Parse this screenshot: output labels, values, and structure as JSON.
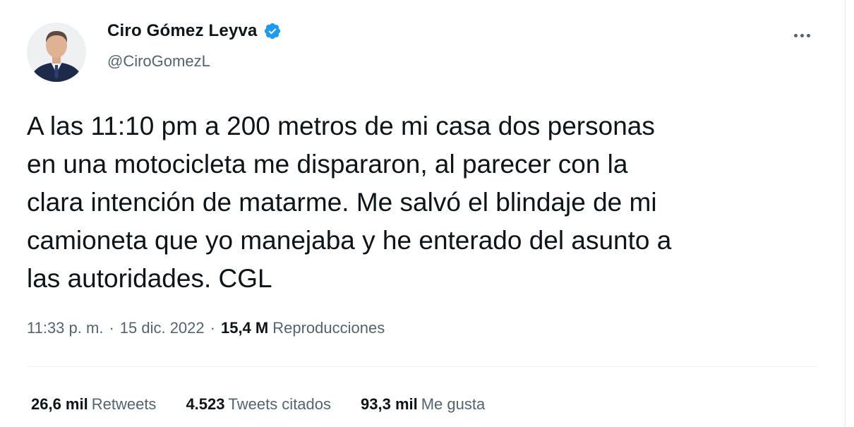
{
  "author": {
    "display_name": "Ciro Gómez Leyva",
    "handle": "@CiroGomezL",
    "verified": true,
    "avatar_icon": "profile-photo"
  },
  "more_icon": "more-options-icon",
  "tweet": {
    "text": "A las 11:10 pm a 200 metros de mi casa dos personas\nen una motocicleta me dispararon, al parecer con la\nclara intención de matarme. Me salvó el blindaje de mi\ncamioneta que yo manejaba y he enterado del asunto a\nlas autoridades. CGL"
  },
  "meta": {
    "time": "11:33 p. m.",
    "separator": "·",
    "date": "15 dic. 2022",
    "views_count": "15,4 M",
    "views_label": "Reproducciones"
  },
  "stats": [
    {
      "count": "26,6 mil",
      "label": "Retweets"
    },
    {
      "count": "4.523",
      "label": "Tweets citados"
    },
    {
      "count": "93,3 mil",
      "label": "Me gusta"
    }
  ],
  "colors": {
    "text_primary": "#0f1419",
    "text_secondary": "#536471",
    "verified_blue": "#1d9bf0",
    "divider": "#eff3f4"
  }
}
